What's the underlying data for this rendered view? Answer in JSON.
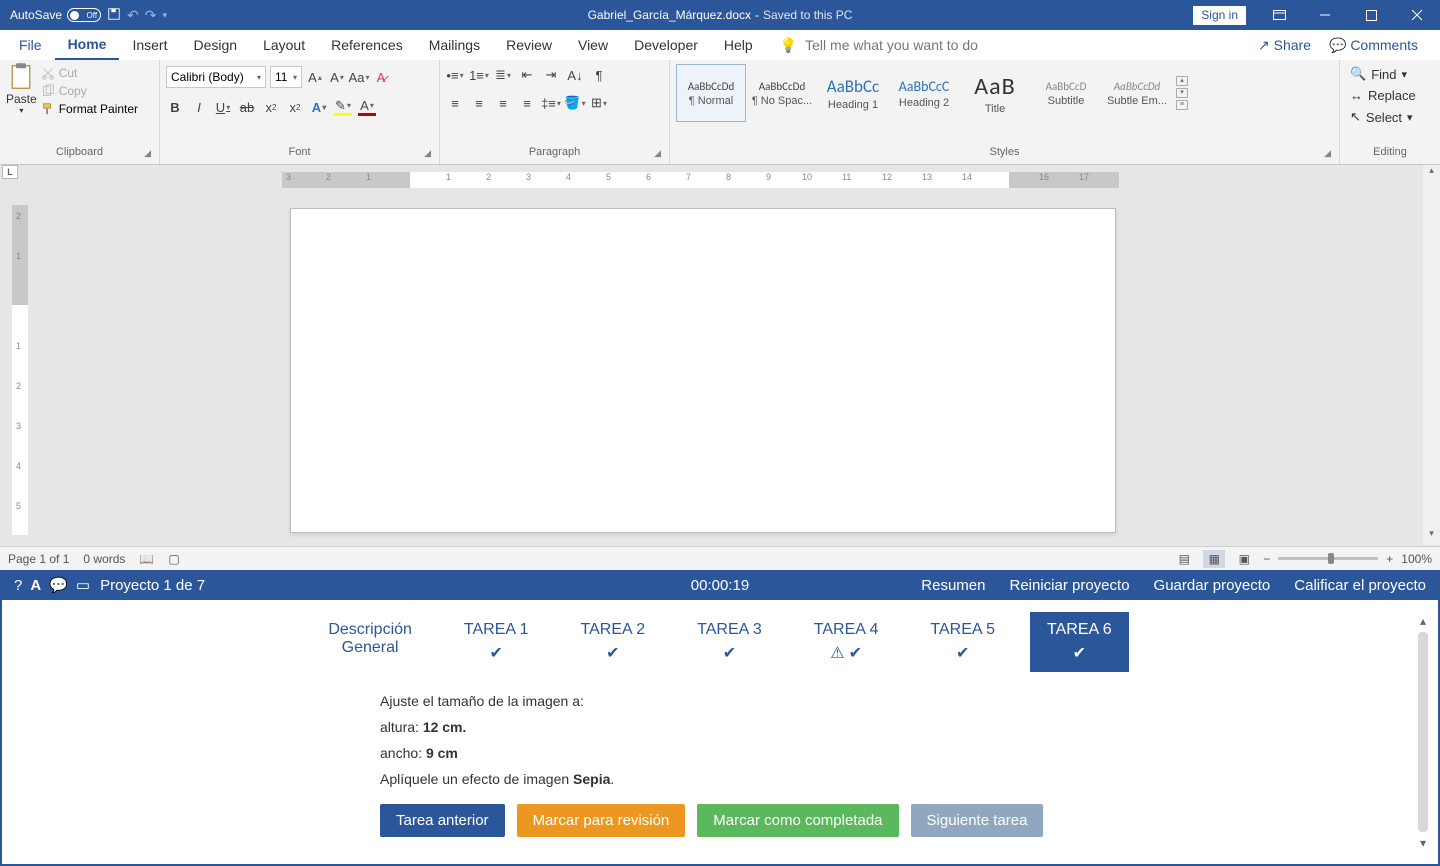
{
  "titlebar": {
    "autosave_label": "AutoSave",
    "autosave_state": "Off",
    "doc_name": "Gabriel_García_Márquez.docx",
    "sep": "-",
    "saved_status": "Saved to this PC",
    "signin": "Sign in"
  },
  "tabs": {
    "file": "File",
    "home": "Home",
    "insert": "Insert",
    "design": "Design",
    "layout": "Layout",
    "references": "References",
    "mailings": "Mailings",
    "review": "Review",
    "view": "View",
    "developer": "Developer",
    "help": "Help",
    "tellme": "Tell me what you want to do",
    "share": "Share",
    "comments": "Comments"
  },
  "ribbon": {
    "clipboard": {
      "paste": "Paste",
      "cut": "Cut",
      "copy": "Copy",
      "format_painter": "Format Painter",
      "label": "Clipboard"
    },
    "font": {
      "name": "Calibri (Body)",
      "size": "11",
      "label": "Font"
    },
    "paragraph": {
      "label": "Paragraph"
    },
    "styles": {
      "label": "Styles",
      "items": [
        {
          "preview": "AaBbCcDd",
          "name": "¶ Normal",
          "cls": ""
        },
        {
          "preview": "AaBbCcDd",
          "name": "¶ No Spac...",
          "cls": ""
        },
        {
          "preview": "AaBbCc",
          "name": "Heading 1",
          "cls": "h1"
        },
        {
          "preview": "AaBbCcD",
          "name": "Heading 2",
          "cls": "h2"
        },
        {
          "preview": "AaB",
          "name": "Title",
          "cls": "title"
        },
        {
          "preview": "AaBbCcD",
          "name": "Subtitle",
          "cls": "sub"
        },
        {
          "preview": "AaBbCcDd",
          "name": "Subtle Em...",
          "cls": "em"
        }
      ]
    },
    "editing": {
      "find": "Find",
      "replace": "Replace",
      "select": "Select",
      "label": "Editing"
    }
  },
  "status": {
    "page": "Page 1 of 1",
    "words": "0 words",
    "zoom": "100%"
  },
  "tabstop_label": "L",
  "projbar": {
    "title": "Proyecto 1 de 7",
    "timer": "00:00:19",
    "resumen": "Resumen",
    "reiniciar": "Reiniciar proyecto",
    "guardar": "Guardar proyecto",
    "calificar": "Calificar el proyecto"
  },
  "tasktabs": {
    "desc1": "Descripción",
    "desc2": "General",
    "t1": "TAREA 1",
    "t2": "TAREA 2",
    "t3": "TAREA 3",
    "t4": "TAREA 4",
    "t5": "TAREA 5",
    "t6": "TAREA 6"
  },
  "task_body": {
    "line1": "Ajuste el tamaño de la imagen a:",
    "line2a": "altura: ",
    "line2b": "12 cm.",
    "line3a": "ancho: ",
    "line3b": "9 cm",
    "line4a": "Aplíquele un efecto de imagen ",
    "line4b": "Sepia",
    "line4c": "."
  },
  "buttons": {
    "prev": "Tarea anterior",
    "mark": "Marcar para revisión",
    "complete": "Marcar como completada",
    "next": "Siguiente tarea"
  }
}
